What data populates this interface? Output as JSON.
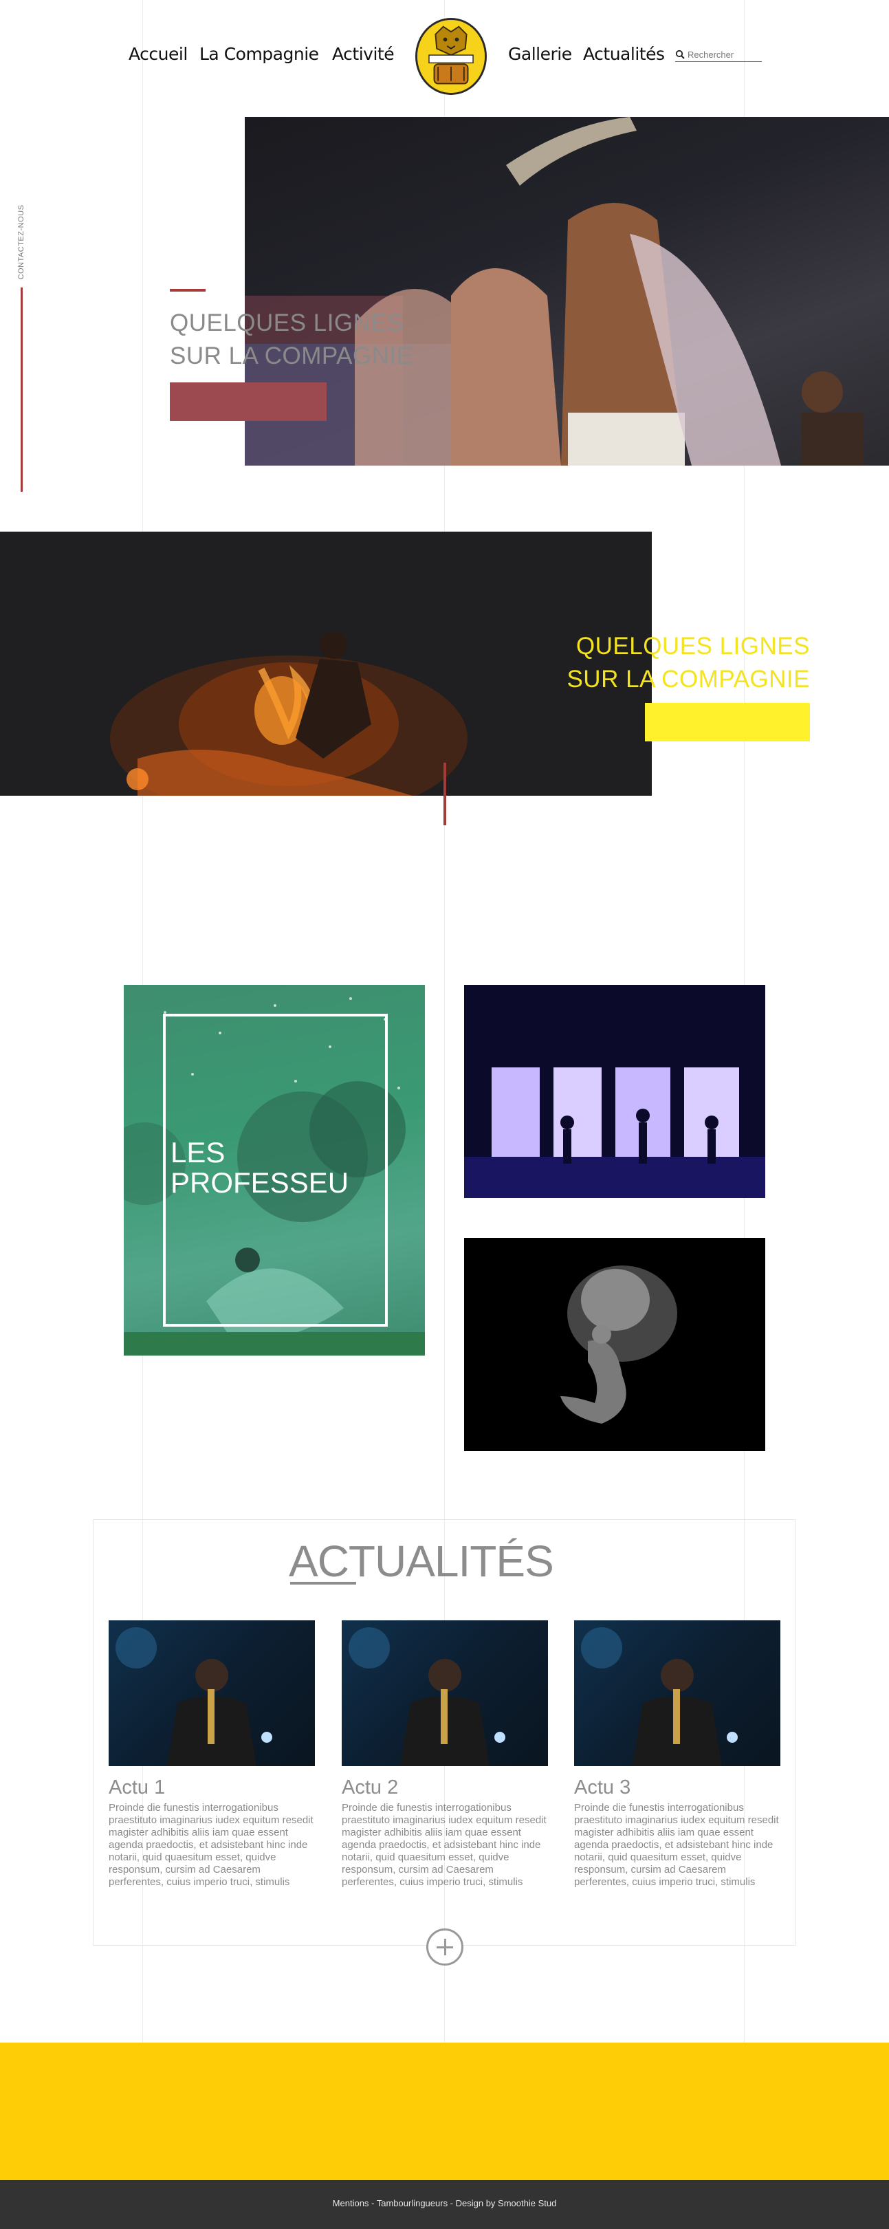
{
  "nav": {
    "left": [
      {
        "label": "Accueil"
      },
      {
        "label": "La Compagnie"
      },
      {
        "label": "Activité"
      }
    ],
    "right": [
      {
        "label": "Gallerie"
      },
      {
        "label": "Actualités"
      }
    ],
    "search_placeholder": "Rechercher",
    "logo_icon": "tiger-logo-icon"
  },
  "side": {
    "contact_label": "CONTACTEZ-NOUS"
  },
  "hero1": {
    "title": "QUELQUES LIGNES\nSUR LA COMPAGNIE",
    "button_label": ""
  },
  "hero2": {
    "title": "QUELQUES LIGNES\nSUR LA COMPAGNIE",
    "button_label": ""
  },
  "gallery": {
    "professeurs_label": "LES\nPROFESSEU"
  },
  "news": {
    "title": "ACTUALITÉS",
    "items": [
      {
        "title": "Actu 1",
        "text": "Proinde die funestis interrogationibus praestituto imaginarius iudex equitum resedit magister adhibitis aliis iam quae essent agenda praedoctis, et adsistebant hinc inde notarii, quid quaesitum esset, quidve responsum, cursim ad Caesarem perferentes, cuius imperio truci, stimulis"
      },
      {
        "title": "Actu 2",
        "text": "Proinde die funestis interrogationibus praestituto imaginarius iudex equitum resedit magister adhibitis aliis iam quae essent agenda praedoctis, et adsistebant hinc inde notarii, quid quaesitum esset, quidve responsum, cursim ad Caesarem perferentes, cuius imperio truci, stimulis"
      },
      {
        "title": "Actu 3",
        "text": "Proinde die funestis interrogationibus praestituto imaginarius iudex equitum resedit magister adhibitis aliis iam quae essent agenda praedoctis, et adsistebant hinc inde notarii, quid quaesitum esset, quidve responsum, cursim ad Caesarem perferentes, cuius imperio truci, stimulis"
      }
    ],
    "more_icon": "plus-circle-icon"
  },
  "footer": {
    "text": "Mentions - Tambourlingueurs - Design by Smoothie Stud"
  },
  "colors": {
    "accent_red": "#a43b3b",
    "accent_yellow": "#f3e41f",
    "footer_yellow": "#ffcd05",
    "footer_dark": "#333333"
  }
}
